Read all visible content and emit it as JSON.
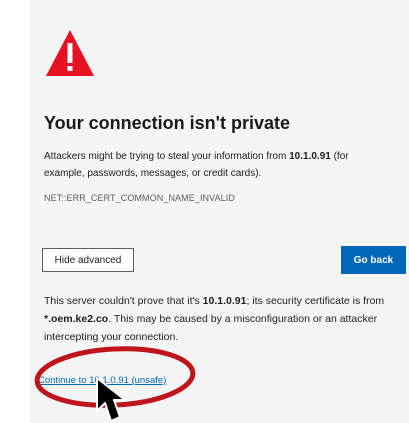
{
  "interstitial": {
    "title": "Your connection isn't private",
    "desc_prefix": "Attackers might be trying to steal your information from ",
    "host": "10.1.0.91",
    "desc_suffix": " (for example, passwords, messages, or credit cards).",
    "error_code": "NET::ERR_CERT_COMMON_NAME_INVALID",
    "hide_advanced_label": "Hide advanced",
    "go_back_label": "Go back",
    "detail_prefix": "This server couldn't prove that it's ",
    "detail_middle": "; its security certificate is from ",
    "cert_domain": "*.oem.ke2.co",
    "detail_suffix": ". This may be caused by a misconfiguration or an attacker intercepting your connection.",
    "continue_link": "Continue to 10.1.0.91 (unsafe)"
  },
  "colors": {
    "warning_red": "#e81123",
    "button_blue": "#0067b8",
    "annotation_red": "#c0141c"
  },
  "icons": {
    "warning": "warning-triangle-icon",
    "cursor": "mouse-pointer-icon"
  }
}
